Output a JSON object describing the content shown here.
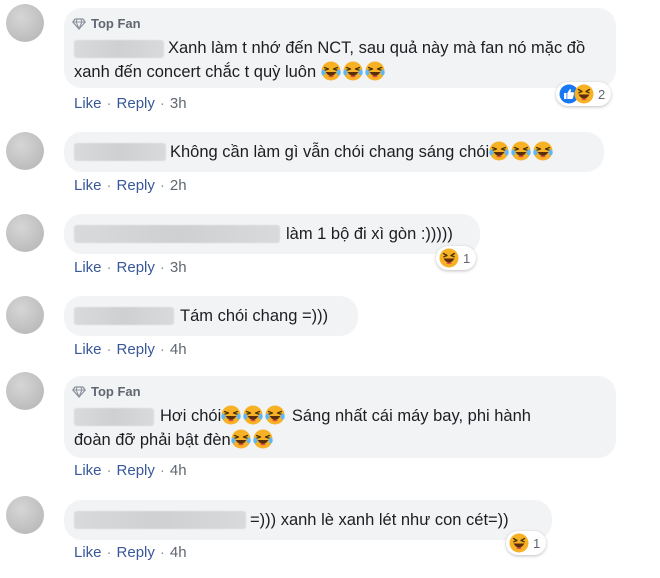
{
  "comments": [
    {
      "top_fan": "Top Fan",
      "line1": "Xanh làm t nhớ đến NCT, sau quả này mà fan nó mặc đồ",
      "line2": "xanh đến concert chắc t quỳ luôn",
      "like": "Like",
      "reply": "Reply",
      "time": "3h",
      "reaction_count": "2",
      "reaction_icons": [
        "like-icon",
        "laugh-icon"
      ]
    },
    {
      "text": "Không cần làm gì vẫn chói chang sáng chói",
      "like": "Like",
      "reply": "Reply",
      "time": "2h"
    },
    {
      "text": "làm 1 bộ đi xì gòn :)))))",
      "like": "Like",
      "reply": "Reply",
      "time": "3h",
      "reaction_count": "1",
      "reaction_icons": [
        "laugh-icon"
      ]
    },
    {
      "text": "Tám chói chang =)))",
      "like": "Like",
      "reply": "Reply",
      "time": "4h"
    },
    {
      "top_fan": "Top Fan",
      "line1a": "Hơi chói",
      "line1b": " Sáng nhất cái máy bay, phi hành",
      "line2": "đoàn đỡ phải bật đèn",
      "like": "Like",
      "reply": "Reply",
      "time": "4h"
    },
    {
      "text": "=))) xanh lè xanh lét như con cét=))",
      "like": "Like",
      "reply": "Reply",
      "time": "4h",
      "reaction_count": "1",
      "reaction_icons": [
        "laugh-icon"
      ]
    }
  ],
  "colors": {
    "bubble": "#f2f3f5",
    "link": "#385898",
    "like_blue": "#1877f2",
    "emoji_yellow": "#f7b125"
  }
}
